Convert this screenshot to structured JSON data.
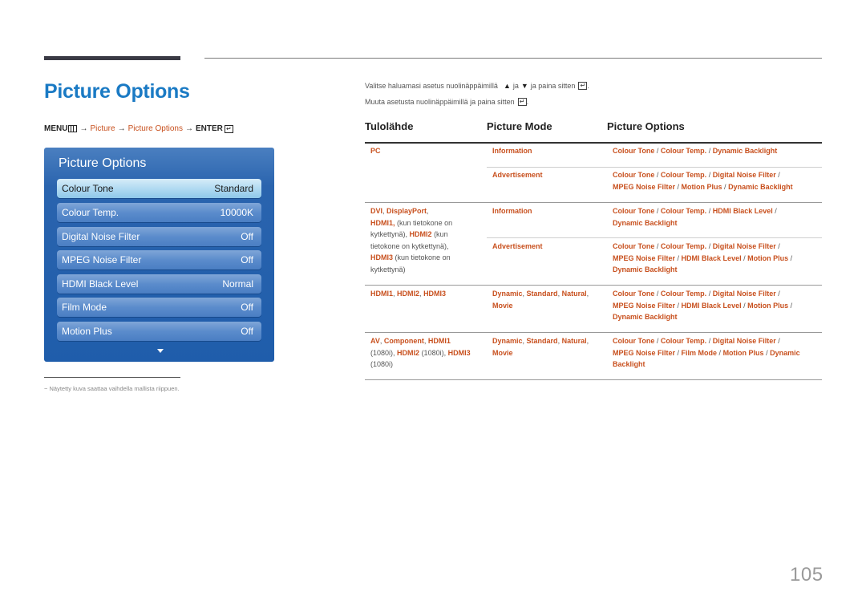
{
  "page": {
    "title": "Picture Options",
    "page_number": "105",
    "accent_color": "#1a7ac4",
    "link_color": "#c8501e"
  },
  "menu_path": {
    "menu": "MENU",
    "menu_icon": "menu-grid-icon",
    "arrow": "→",
    "step1": "Picture",
    "step2": "Picture Options",
    "enter": "ENTER",
    "enter_icon": "enter-key-icon",
    "enter_glyph": "↵"
  },
  "osd": {
    "title": "Picture Options",
    "items": [
      {
        "label": "Colour Tone",
        "value": "Standard",
        "selected": true
      },
      {
        "label": "Colour Temp.",
        "value": "10000K"
      },
      {
        "label": "Digital Noise Filter",
        "value": "Off"
      },
      {
        "label": "MPEG Noise Filter",
        "value": "Off"
      },
      {
        "label": "HDMI Black Level",
        "value": "Normal"
      },
      {
        "label": "Film Mode",
        "value": "Off"
      },
      {
        "label": "Motion Plus",
        "value": "Off"
      }
    ],
    "more_icon": "scroll-down-arrow-icon"
  },
  "footnote": {
    "dash": "−",
    "text": "Näytetty kuva saattaa vaihdella mallista riippuen."
  },
  "instructions": {
    "line1_a": "Valitse haluamasi asetus nuolinäppäimillä",
    "up": "▲",
    "and": "ja",
    "down": "▼",
    "line1_b": "ja paina sitten",
    "line2": "Muuta asetusta nuolinäppäimillä ja paina sitten",
    "enter_glyph": "↵",
    "period": "."
  },
  "table": {
    "headers": [
      "Tulolähde",
      "Picture Mode",
      "Picture Options"
    ],
    "rows": [
      {
        "source": "PC",
        "modes": [
          {
            "mode": "Information",
            "options": "Colour Tone / Colour Temp. / Dynamic Backlight"
          },
          {
            "mode": "Advertisement",
            "options": "Colour Tone / Colour Temp. / Digital Noise Filter / MPEG Noise Filter / Motion Plus / Dynamic Backlight"
          }
        ]
      },
      {
        "source": "DVI, DisplayPort, HDMI1, (kun tietokone on kytkettynä), HDMI2 (kun tietokone on kytkettynä), HDMI3 (kun tietokone on kytkettynä)",
        "modes": [
          {
            "mode": "Information",
            "options": "Colour Tone / Colour Temp. / HDMI Black Level / Dynamic Backlight"
          },
          {
            "mode": "Advertisement",
            "options": "Colour Tone / Colour Temp. / Digital Noise Filter / MPEG Noise Filter / HDMI Black Level / Motion Plus / Dynamic Backlight"
          }
        ]
      },
      {
        "source": "HDMI1, HDMI2, HDMI3",
        "modes": [
          {
            "mode": "Dynamic, Standard, Natural, Movie",
            "options": "Colour Tone / Colour Temp. / Digital Noise Filter / MPEG Noise Filter / HDMI Black Level / Motion Plus / Dynamic Backlight"
          }
        ]
      },
      {
        "source": "AV, Component, HDMI1 (1080i), HDMI2 (1080i), HDMI3 (1080i)",
        "modes": [
          {
            "mode": "Dynamic, Standard, Natural, Movie",
            "options": "Colour Tone / Colour Temp. / Digital Noise Filter / MPEG Noise Filter / Film Mode / Motion Plus / Dynamic Backlight"
          }
        ]
      }
    ],
    "text": {
      "pc": "PC",
      "information": "Information",
      "advertisement": "Advertisement",
      "dvi": "DVI",
      "displayport": "DisplayPort",
      "hdmi1": "HDMI1",
      "hdmi2": "HDMI2",
      "hdmi3": "HDMI3",
      "kun1": "(kun tietokone on",
      "kytk1": "kytkettynä),",
      "kun2": "(kun",
      "tieto2": "tietokone on kytkettynä),",
      "kun3": "(kun tietokone on",
      "kytk3": "kytkettynä)",
      "av": "AV",
      "component": "Component",
      "i1080": "(1080i)",
      "dynamic": "Dynamic",
      "standard": "Standard",
      "natural": "Natural",
      "movie": "Movie",
      "colour_tone": "Colour Tone",
      "colour_temp": "Colour Temp.",
      "dynamic_backlight": "Dynamic Backlight",
      "dynamic_w": "Dynamic",
      "backlight_w": "Backlight",
      "digital_noise": "Digital Noise Filter",
      "mpeg_noise": "MPEG Noise Filter",
      "motion_plus": "Motion Plus",
      "hdmi_black": "HDMI Black Level",
      "film_mode": "Film Mode",
      "slash": " / ",
      "comma": ", "
    }
  }
}
